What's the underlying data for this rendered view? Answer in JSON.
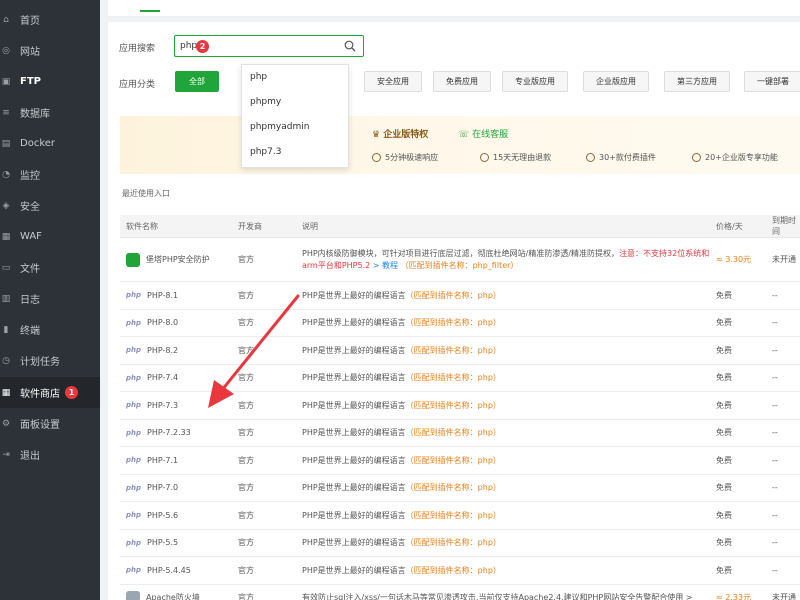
{
  "sidebar": {
    "items": [
      {
        "label": "首页",
        "icon": "home-icon"
      },
      {
        "label": "网站",
        "icon": "globe-icon"
      },
      {
        "label": "FTP",
        "icon": "ftp-icon"
      },
      {
        "label": "数据库",
        "icon": "database-icon"
      },
      {
        "label": "Docker",
        "icon": "docker-icon"
      },
      {
        "label": "监控",
        "icon": "monitor-icon"
      },
      {
        "label": "安全",
        "icon": "shield-icon"
      },
      {
        "label": "WAF",
        "icon": "firewall-icon"
      },
      {
        "label": "文件",
        "icon": "folder-icon"
      },
      {
        "label": "日志",
        "icon": "log-icon"
      },
      {
        "label": "终端",
        "icon": "terminal-icon"
      },
      {
        "label": "计划任务",
        "icon": "clock-icon"
      },
      {
        "label": "软件商店",
        "icon": "store-icon",
        "badge": "1"
      },
      {
        "label": "面板设置",
        "icon": "settings-icon"
      },
      {
        "label": "退出",
        "icon": "logout-icon"
      }
    ]
  },
  "search": {
    "label": "应用搜索",
    "value": "php",
    "badge": "2"
  },
  "dropdown": {
    "options": [
      "php",
      "phpmy",
      "phpmyadmin",
      "php7.3"
    ]
  },
  "category": {
    "label": "应用分类",
    "buttons": [
      "全部",
      "安全应用",
      "免费应用",
      "专业版应用",
      "企业版应用",
      "第三方应用",
      "一键部署"
    ]
  },
  "banner": {
    "title": "企业版特权",
    "service": "在线客服",
    "features": [
      "5分钟极速响应",
      "15天无理由退款",
      "30+款付费插件",
      "20+企业版专享功能"
    ]
  },
  "recent_label": "最近使用入口",
  "table": {
    "headers": [
      "软件名称",
      "开发商",
      "说明",
      "价格/天",
      "到期时间"
    ],
    "first_row": {
      "name": "堡塔PHP安全防护",
      "dev": "官方",
      "desc_a": "PHP内核级防御模块，可针对项目进行底层过滤，彻底杜绝网站/精准防渗透/精准防提权，",
      "desc_note": "注意：不支持32位系统和arm平台和PHP5.2",
      "desc_link": "> 教程",
      "desc_match": "（匹配到插件名称：php_filter）",
      "price": "≈ 3.30元",
      "expire": "未开通"
    },
    "php_rows": [
      {
        "name": "PHP-8.1"
      },
      {
        "name": "PHP-8.0"
      },
      {
        "name": "PHP-8.2"
      },
      {
        "name": "PHP-7.4"
      },
      {
        "name": "PHP-7.3"
      },
      {
        "name": "PHP-7.2.33"
      },
      {
        "name": "PHP-7.1"
      },
      {
        "name": "PHP-7.0"
      },
      {
        "name": "PHP-5.6"
      },
      {
        "name": "PHP-5.5"
      },
      {
        "name": "PHP-5.4.45"
      }
    ],
    "php_common": {
      "dev": "官方",
      "desc": "PHP是世界上最好的编程语言",
      "match": "（匹配到插件名称：php）",
      "price": "免费",
      "expire": "--",
      "logo": "php"
    },
    "last_row": {
      "name": "Apache防火墙",
      "dev": "官方",
      "desc": "有效防止sql注入/xss/一句话木马等常见渗透攻击,当前仅支持Apache2.4,建议和PHP网站安全告警配合使用 >",
      "price": "≈ 2.33元",
      "expire": "未开通"
    }
  },
  "colors": {
    "accent": "#20a53a",
    "sidebar_bg": "#2d3238",
    "badge": "#e8383d",
    "orange": "#e8801a",
    "arrow": "#e8383d"
  }
}
